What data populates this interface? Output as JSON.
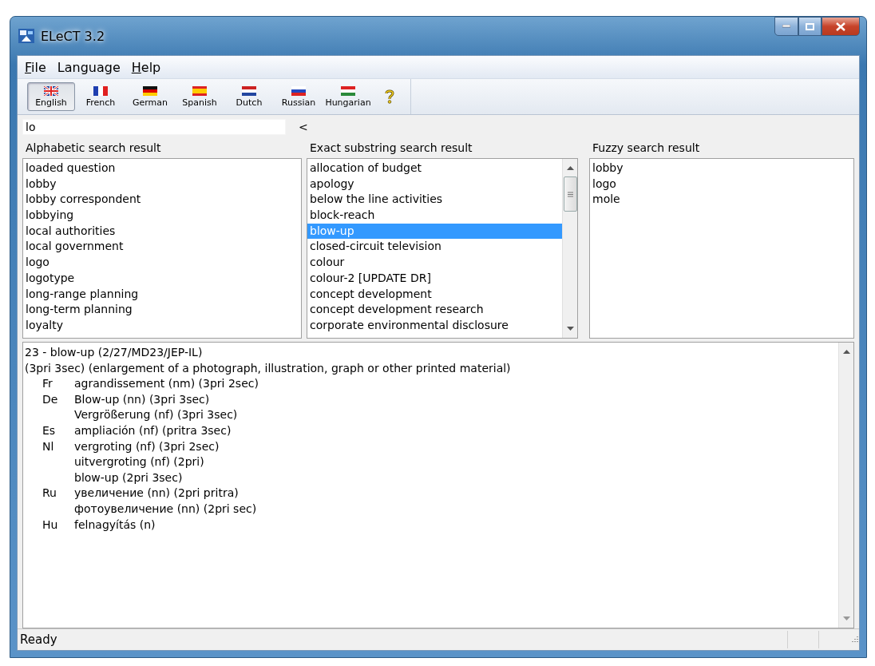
{
  "window": {
    "title": "ELeCT 3.2"
  },
  "menu": [
    {
      "label": "File",
      "underline_first": true
    },
    {
      "label": "Language",
      "underline_first": false
    },
    {
      "label": "Help",
      "underline_first": true
    }
  ],
  "toolbar": [
    {
      "kind": "uk",
      "label": "English",
      "selected": true
    },
    {
      "kind": "fr",
      "label": "French",
      "selected": false
    },
    {
      "kind": "de",
      "label": "German",
      "selected": false
    },
    {
      "kind": "es",
      "label": "Spanish",
      "selected": false
    },
    {
      "kind": "nl",
      "label": "Dutch",
      "selected": false
    },
    {
      "kind": "ru",
      "label": "Russian",
      "selected": false
    },
    {
      "kind": "hu",
      "label": "Hungarian",
      "selected": false
    },
    {
      "kind": "help",
      "selected": false
    }
  ],
  "search": {
    "value": "lo",
    "button": "<"
  },
  "lists": [
    {
      "title": "Alphabetic search result",
      "scrollbar": false,
      "items": [
        {
          "label": "loaded question",
          "selected": false
        },
        {
          "label": "lobby",
          "selected": false
        },
        {
          "label": "lobby correspondent",
          "selected": false
        },
        {
          "label": "lobbying",
          "selected": false
        },
        {
          "label": "local authorities",
          "selected": false
        },
        {
          "label": "local government",
          "selected": false
        },
        {
          "label": "logo",
          "selected": false
        },
        {
          "label": "logotype",
          "selected": false
        },
        {
          "label": "long-range planning",
          "selected": false
        },
        {
          "label": "long-term planning",
          "selected": false
        },
        {
          "label": "loyalty",
          "selected": false
        }
      ]
    },
    {
      "title": "Exact substring search result",
      "scrollbar": true,
      "items": [
        {
          "label": "allocation of budget",
          "selected": false
        },
        {
          "label": "apology",
          "selected": false
        },
        {
          "label": "below the line activities",
          "selected": false
        },
        {
          "label": "block-reach",
          "selected": false
        },
        {
          "label": "blow-up",
          "selected": true
        },
        {
          "label": "closed-circuit television",
          "selected": false
        },
        {
          "label": "colour",
          "selected": false
        },
        {
          "label": "colour-2 [UPDATE DR]",
          "selected": false
        },
        {
          "label": "concept development",
          "selected": false
        },
        {
          "label": "concept development research",
          "selected": false
        },
        {
          "label": "corporate environmental disclosure",
          "selected": false
        }
      ]
    },
    {
      "title": "Fuzzy search result",
      "scrollbar": false,
      "items": [
        {
          "label": "lobby",
          "selected": false
        },
        {
          "label": "logo",
          "selected": false
        },
        {
          "label": "mole",
          "selected": false
        }
      ]
    }
  ],
  "detail": {
    "heading": "23  -  blow-up (2/27/MD23/JEP-IL)",
    "definition": "(3pri 3sec) (enlargement of a photograph, illustration, graph or other printed material)",
    "translations": [
      {
        "lang": "Fr",
        "terms": [
          "agrandissement (nm) (3pri 2sec)"
        ]
      },
      {
        "lang": "De",
        "terms": [
          "Blow-up (nn) (3pri 3sec)",
          "Vergrößerung (nf) (3pri 3sec)"
        ]
      },
      {
        "lang": "Es",
        "terms": [
          "ampliación (nf) (pritra 3sec)"
        ]
      },
      {
        "lang": "Nl",
        "terms": [
          "vergroting (nf) (3pri 2sec)",
          "uitvergroting (nf) (2pri)",
          "blow-up (2pri 3sec)"
        ]
      },
      {
        "lang": "Ru",
        "terms": [
          "увеличение (nn) (2pri pritra)",
          "фотоувеличение (nn) (2pri sec)"
        ]
      },
      {
        "lang": "Hu",
        "terms": [
          "felnagyítás (n)"
        ]
      }
    ]
  },
  "status_bar": {
    "text": "Ready"
  }
}
